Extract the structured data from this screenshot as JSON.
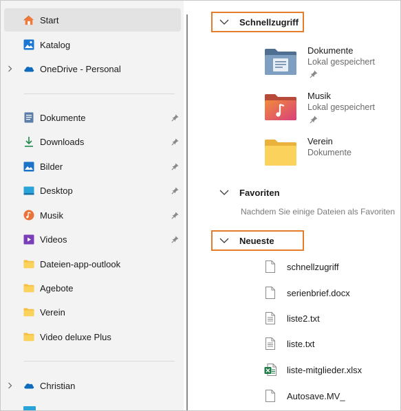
{
  "sidebar": {
    "items": [
      {
        "label": "Start",
        "icon": "home-icon"
      },
      {
        "label": "Katalog",
        "icon": "gallery-icon"
      },
      {
        "label": "OneDrive - Personal",
        "icon": "onedrive-cloud-icon"
      }
    ],
    "pinned": [
      {
        "label": "Dokumente",
        "icon": "documents-icon"
      },
      {
        "label": "Downloads",
        "icon": "download-arrow-icon"
      },
      {
        "label": "Bilder",
        "icon": "pictures-icon"
      },
      {
        "label": "Desktop",
        "icon": "desktop-icon"
      },
      {
        "label": "Musik",
        "icon": "music-icon"
      },
      {
        "label": "Videos",
        "icon": "videos-icon"
      },
      {
        "label": "Dateien-app-outlook",
        "icon": "folder-icon"
      },
      {
        "label": "Agebote",
        "icon": "folder-icon"
      },
      {
        "label": "Verein",
        "icon": "folder-icon"
      },
      {
        "label": "Video deluxe Plus",
        "icon": "folder-icon"
      }
    ],
    "bottom": [
      {
        "label": "Christian",
        "icon": "onedrive-cloud-icon"
      }
    ]
  },
  "main": {
    "quick_access": {
      "title": "Schnellzugriff",
      "items": [
        {
          "name": "Dokumente",
          "sub": "Lokal gespeichert"
        },
        {
          "name": "Musik",
          "sub": "Lokal gespeichert"
        },
        {
          "name": "Verein",
          "sub": "Dokumente"
        }
      ]
    },
    "favorites": {
      "title": "Favoriten",
      "note": "Nachdem Sie einige Dateien als Favoriten"
    },
    "recent": {
      "title": "Neueste",
      "files": [
        {
          "name": "schnellzugriff",
          "icon": "blank-file-icon"
        },
        {
          "name": "serienbrief.docx",
          "icon": "blank-file-icon"
        },
        {
          "name": "liste2.txt",
          "icon": "text-file-icon"
        },
        {
          "name": "liste.txt",
          "icon": "text-file-icon"
        },
        {
          "name": "liste-mitglieder.xlsx",
          "icon": "excel-file-icon"
        },
        {
          "name": "Autosave.MV_",
          "icon": "blank-file-icon"
        }
      ]
    }
  },
  "colors": {
    "highlight": "#e57c2a",
    "selected": "#e3e3e3",
    "sidebar_bg": "#f3f3f3"
  }
}
